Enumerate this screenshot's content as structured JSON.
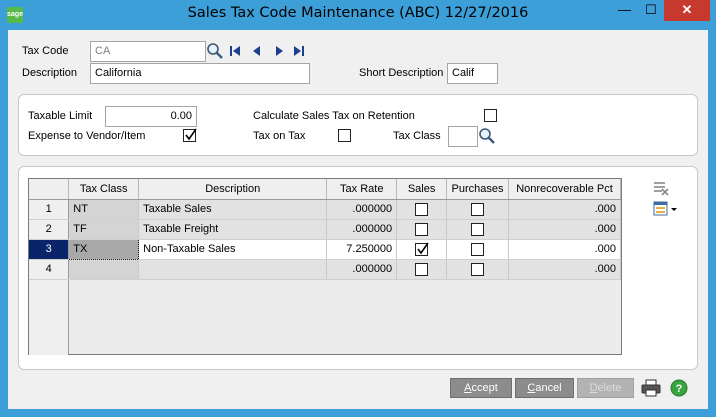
{
  "window": {
    "app_icon_text": "sage",
    "title": "Sales Tax Code Maintenance (ABC) 12/27/2016",
    "minimize_glyph": "—",
    "maximize_glyph": "☐",
    "close_glyph": "✕"
  },
  "header": {
    "tax_code_label": "Tax Code",
    "tax_code_value": "CA",
    "description_label": "Description",
    "description_value": "California",
    "short_description_label": "Short Description",
    "short_description_value": "Calif",
    "nav_icons": [
      "lookup-icon",
      "first-record-icon",
      "previous-record-icon",
      "next-record-icon",
      "last-record-icon"
    ]
  },
  "settings": {
    "taxable_limit_label": "Taxable Limit",
    "taxable_limit_value": "0.00",
    "expense_label": "Expense to Vendor/Item",
    "expense_checked": true,
    "calc_retention_label": "Calculate Sales Tax on Retention",
    "calc_retention_checked": false,
    "tax_on_tax_label": "Tax on Tax",
    "tax_on_tax_checked": false,
    "tax_class_label": "Tax Class",
    "tax_class_value": ""
  },
  "grid": {
    "columns": [
      "",
      "Tax Class",
      "Description",
      "Tax Rate",
      "Sales",
      "Purchases",
      "Nonrecoverable Pct"
    ],
    "rows": [
      {
        "num": "1",
        "tax_class": "NT",
        "description": "Taxable Sales",
        "tax_rate": ".000000",
        "sales": false,
        "purchases": false,
        "nonrecoverable": ".000"
      },
      {
        "num": "2",
        "tax_class": "TF",
        "description": "Taxable Freight",
        "tax_rate": ".000000",
        "sales": false,
        "purchases": false,
        "nonrecoverable": ".000"
      },
      {
        "num": "3",
        "tax_class": "TX",
        "description": "Non-Taxable Sales",
        "tax_rate": "7.250000",
        "sales": true,
        "purchases": false,
        "nonrecoverable": ".000"
      },
      {
        "num": "4",
        "tax_class": "",
        "description": "",
        "tax_rate": ".000000",
        "sales": false,
        "purchases": false,
        "nonrecoverable": ".000"
      }
    ],
    "side_icons": [
      "delete-row-icon",
      "customize-grid-icon"
    ]
  },
  "buttons": {
    "accept": "ccept",
    "accept_mnemonic": "A",
    "cancel": "ancel",
    "cancel_mnemonic": "C",
    "delete": "elete",
    "delete_mnemonic": "D"
  },
  "colors": {
    "title_bar": "#3c9fd8",
    "close_button": "#c7392f",
    "selected_row": "#0a246a"
  }
}
